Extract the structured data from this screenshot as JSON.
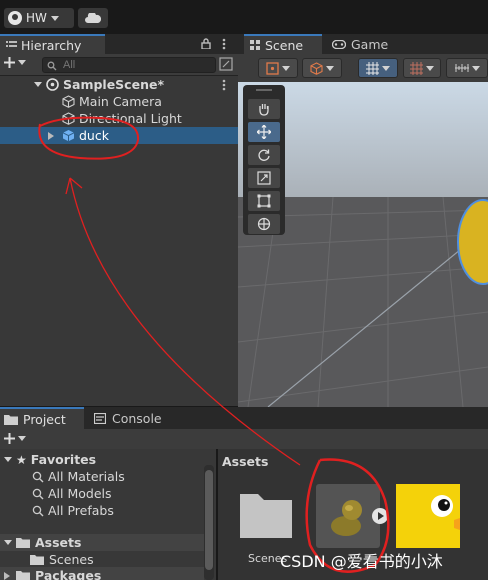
{
  "toolbar": {
    "account_label": "HW"
  },
  "hierarchy": {
    "tab_label": "Hierarchy",
    "search_placeholder": "All",
    "scene_name": "SampleScene*",
    "items": [
      {
        "label": "Main Camera"
      },
      {
        "label": "Directional Light"
      },
      {
        "label": "duck",
        "selected": true
      }
    ]
  },
  "scene_view": {
    "tabs": [
      {
        "label": "Scene"
      },
      {
        "label": "Game"
      }
    ]
  },
  "project": {
    "tabs": [
      {
        "label": "Project"
      },
      {
        "label": "Console"
      }
    ],
    "favorites": {
      "label": "Favorites",
      "items": [
        {
          "label": "All Materials"
        },
        {
          "label": "All Models"
        },
        {
          "label": "All Prefabs"
        }
      ]
    },
    "assets_tree": {
      "label": "Assets",
      "children": [
        {
          "label": "Scenes"
        }
      ]
    },
    "packages_label": "Packages",
    "breadcrumb": "Assets",
    "tiles": [
      {
        "label": "Scenes"
      }
    ]
  },
  "watermark": "CSDN @爱看书的小沐",
  "colors": {
    "selection": "#2c5d87",
    "accent": "#3a79bb",
    "annotation": "#e02020"
  }
}
